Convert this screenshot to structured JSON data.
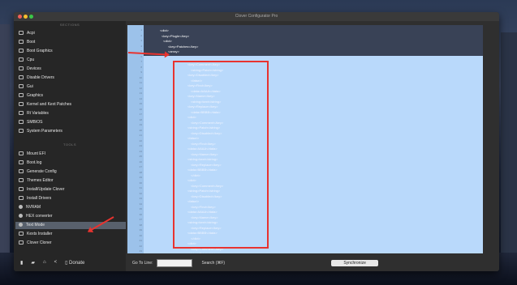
{
  "window": {
    "title": "Clover Configurator Pro"
  },
  "sidebar": {
    "section_sections": "SECTIONS",
    "section_tools": "TOOLS",
    "items": [
      {
        "label": "Acpi"
      },
      {
        "label": "Boot"
      },
      {
        "label": "Boot Graphics"
      },
      {
        "label": "Cpu"
      },
      {
        "label": "Devices"
      },
      {
        "label": "Disable Drivers"
      },
      {
        "label": "Gui"
      },
      {
        "label": "Graphics"
      },
      {
        "label": "Kernel and Kext Patches"
      },
      {
        "label": "Rt Variables"
      },
      {
        "label": "SMBIOS"
      },
      {
        "label": "System Parameters"
      }
    ],
    "tools": [
      {
        "label": "Mount EFI"
      },
      {
        "label": "Boot.log"
      },
      {
        "label": "Generate Config"
      },
      {
        "label": "Themes Editor"
      },
      {
        "label": "Install/Update Clover"
      },
      {
        "label": "Install Drivers"
      },
      {
        "label": "NVRAM"
      },
      {
        "label": "HEX converter"
      },
      {
        "label": "Text Mode"
      },
      {
        "label": "Kexts Installer"
      },
      {
        "label": "Clover Cloner"
      }
    ],
    "donate_label": "Donate"
  },
  "editor": {
    "header_lines": [
      "<dict>",
      "<key>PlugIn</key>",
      "<dict>",
      "<key>Patches</key>",
      "<array>"
    ],
    "body_lines": [
      "<key>Comment</key>",
      "<string>Patch</string>",
      "<key>Disabled</key>",
      "<false/>",
      "<key>Find</key>",
      "<data>AAAA</data>",
      "<key>Name</key>",
      "<string>kext</string>",
      "<key>Replace</key>",
      "<data>BBBB</data>",
      "<dict>",
      "<key>Comment</key>",
      "<string>Patch</string>",
      "<key>Disabled</key>",
      "<false/>",
      "<key>Find</key>",
      "<data>AAAA</data>",
      "<key>Name</key>",
      "<string>kext</string>",
      "<key>Replace</key>",
      "<data>BBBB</data>",
      "</dict>",
      "<dict>",
      "<key>Comment</key>",
      "<string>Patch</string>",
      "<key>Disabled</key>",
      "<false/>",
      "<key>Find</key>",
      "<data>AAAA</data>",
      "<key>Name</key>",
      "<string>kext</string>",
      "<key>Replace</key>",
      "<data>BBBB</data>",
      "</dict>",
      "<dict>",
      "<key>Comment</key>",
      "<string>Patch</string>",
      "<key>Disabled</key>"
    ]
  },
  "status": {
    "goto_label": "Go To Line:",
    "search_label": "Search (⌘F)",
    "sync_label": "Synchronize"
  }
}
